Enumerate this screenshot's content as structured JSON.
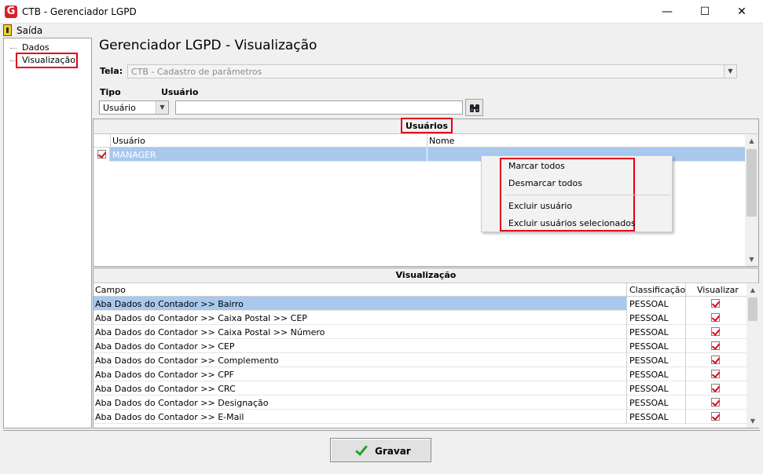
{
  "window": {
    "title": "CTB - Gerenciador LGPD",
    "minimize": "—",
    "maximize": "☐",
    "close": "✕"
  },
  "menubar": {
    "exit_label": "Saída"
  },
  "tree": {
    "items": [
      "Dados",
      "Visualização"
    ]
  },
  "heading": "Gerenciador LGPD - Visualização",
  "tela": {
    "label": "Tela:",
    "value": "CTB - Cadastro de parâmetros"
  },
  "filter": {
    "tipo_label": "Tipo",
    "usuario_label": "Usuário",
    "tipo_value": "Usuário",
    "usuario_value": ""
  },
  "usuarios_panel": {
    "title": "Usuários",
    "columns": [
      "Usuário",
      "Nome"
    ],
    "rows": [
      {
        "checked": true,
        "usuario": "MANAGER",
        "nome": ""
      }
    ]
  },
  "context_menu": {
    "items": [
      "Marcar todos",
      "Desmarcar todos",
      "Excluir usuário",
      "Excluir usuários selecionados"
    ]
  },
  "visualizacao_panel": {
    "title": "Visualização",
    "columns": [
      "Campo",
      "Classificação",
      "Visualizar"
    ],
    "rows": [
      {
        "campo": "Aba Dados do Contador >> Bairro",
        "classificacao": "PESSOAL",
        "visualizar": true
      },
      {
        "campo": "Aba Dados do Contador >> Caixa Postal >> CEP",
        "classificacao": "PESSOAL",
        "visualizar": true
      },
      {
        "campo": "Aba Dados do Contador >> Caixa Postal >> Número",
        "classificacao": "PESSOAL",
        "visualizar": true
      },
      {
        "campo": "Aba Dados do Contador >> CEP",
        "classificacao": "PESSOAL",
        "visualizar": true
      },
      {
        "campo": "Aba Dados do Contador >> Complemento",
        "classificacao": "PESSOAL",
        "visualizar": true
      },
      {
        "campo": "Aba Dados do Contador >> CPF",
        "classificacao": "PESSOAL",
        "visualizar": true
      },
      {
        "campo": "Aba Dados do Contador >> CRC",
        "classificacao": "PESSOAL",
        "visualizar": true
      },
      {
        "campo": "Aba Dados do Contador >> Designação",
        "classificacao": "PESSOAL",
        "visualizar": true
      },
      {
        "campo": "Aba Dados do Contador >> E-Mail",
        "classificacao": "PESSOAL",
        "visualizar": true
      }
    ]
  },
  "footer": {
    "save_label": "Gravar"
  },
  "colors": {
    "accent_red": "#e3001b",
    "selection": "#a8c8ee",
    "check_green": "#2aa02a"
  }
}
